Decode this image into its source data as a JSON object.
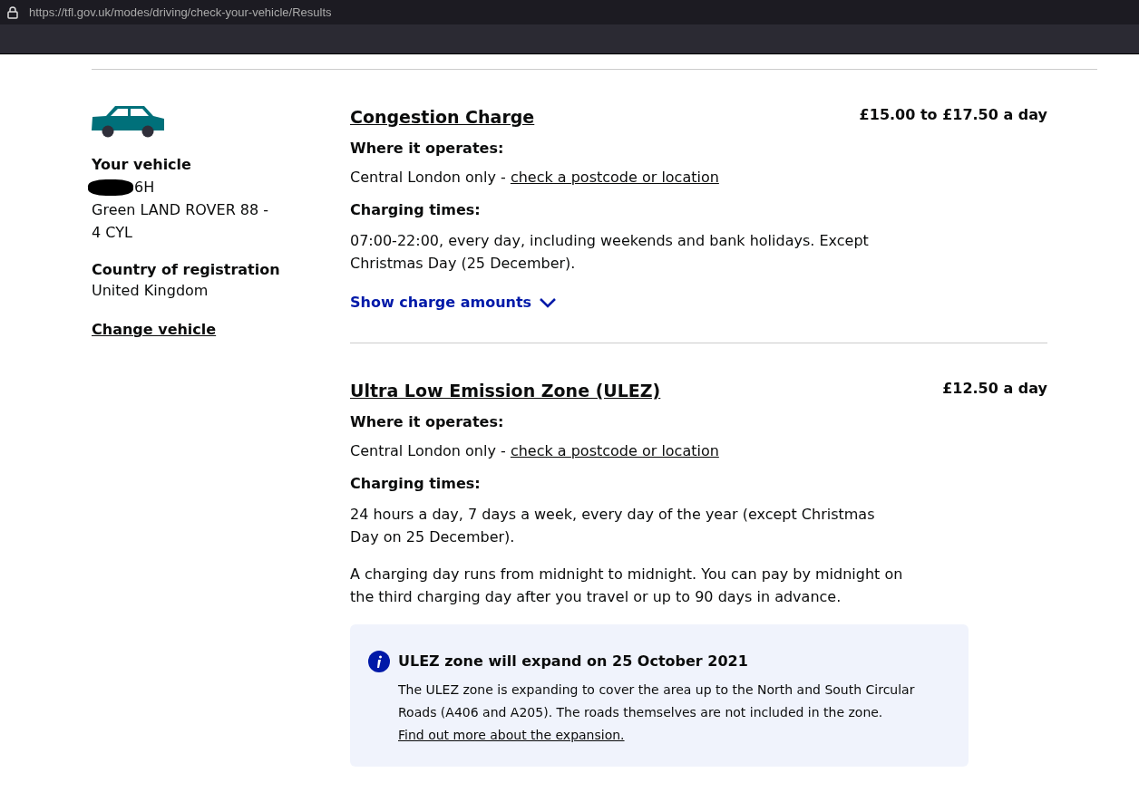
{
  "browser": {
    "url": "https://tfl.gov.uk/modes/driving/check-your-vehicle/Results"
  },
  "vehicle": {
    "heading": "Your vehicle",
    "registration": "6H",
    "registration_redacted": true,
    "description": "Green LAND ROVER 88 - 4 CYL",
    "country_label": "Country of registration",
    "country": "United Kingdom",
    "change_link": "Change vehicle"
  },
  "charges": [
    {
      "title": "Congestion Charge",
      "price": "£15.00 to £17.50 a day",
      "where_label": "Where it operates:",
      "where_text": "Central London only - ",
      "where_link": "check a postcode or location",
      "times_label": "Charging times:",
      "paragraphs": [
        "07:00-22:00, every day, including weekends and bank holidays. Except Christmas Day (25 December)."
      ],
      "toggle": {
        "label": "Show charge amounts",
        "expanded": false
      }
    },
    {
      "title": "Ultra Low Emission Zone (ULEZ)",
      "price": "£12.50 a day",
      "where_label": "Where it operates:",
      "where_text": "Central London only - ",
      "where_link": "check a postcode or location",
      "times_label": "Charging times:",
      "paragraphs": [
        "24 hours a day, 7 days a week, every day of the year (except Christmas Day on 25 December).",
        "A charging day runs from midnight to midnight. You can pay by midnight on the third charging day after you travel or up to 90 days in advance."
      ],
      "notice": {
        "title": "ULEZ zone will expand on 25 October 2021",
        "text": "The ULEZ zone is expanding to cover the area up to the North and South Circular Roads (A406 and A205). The roads themselves are not included in the zone.  ",
        "link": "Find out more about the expansion."
      }
    }
  ]
}
